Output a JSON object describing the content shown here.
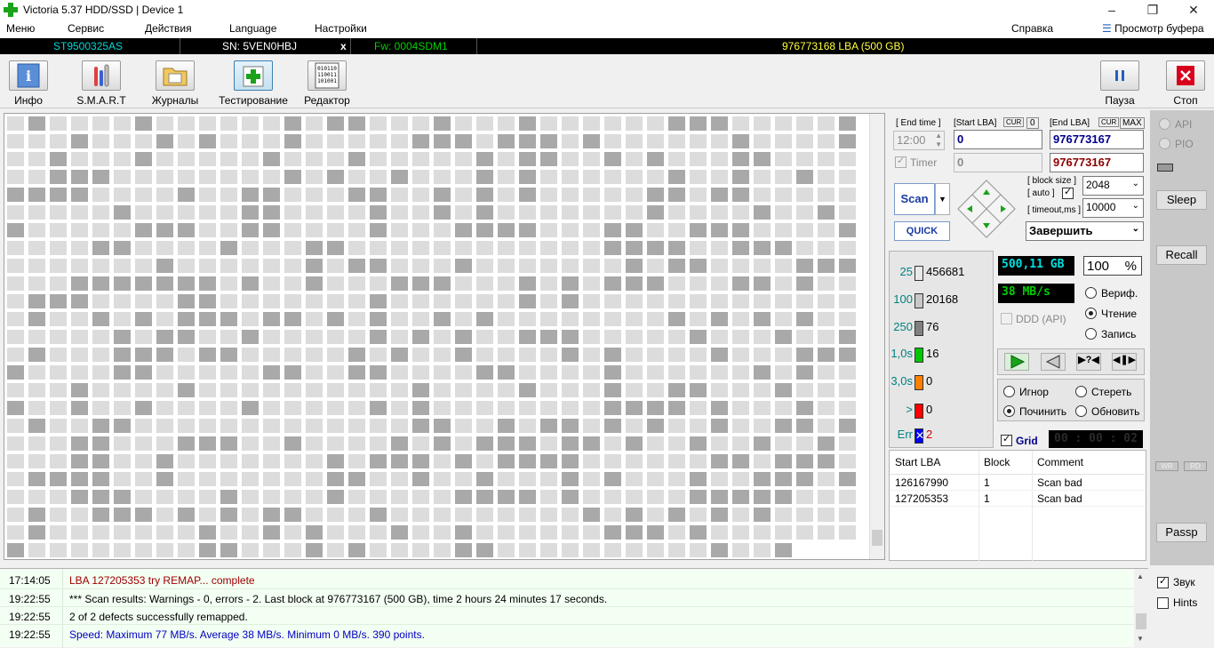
{
  "window": {
    "title": "Victoria 5.37 HDD/SSD | Device 1"
  },
  "menu": {
    "items": [
      "Меню",
      "Сервис",
      "Действия",
      "Language",
      "Настройки"
    ],
    "help": "Справка",
    "buffer_view": "Просмотр буфера"
  },
  "device": {
    "model": "ST9500325AS",
    "serial": "SN: 5VEN0HBJ",
    "close": "x",
    "firmware": "Fw: 0004SDM1",
    "capacity": "976773168 LBA (500 GB)"
  },
  "toolbar": {
    "info": "Инфо",
    "smart": "S.M.A.R.T",
    "logs": "Журналы",
    "testing": "Тестирование",
    "editor": "Редактор",
    "pause": "Пауза",
    "stop": "Стоп"
  },
  "scan": {
    "end_time_label": "[ End time ]",
    "start_lba_label": "[Start LBA]",
    "cur_label": "CUR",
    "cur_value": "0",
    "end_lba_label": "[End LBA]",
    "max_label": "MAX",
    "end_time_value": "12:00",
    "start_lba_value": "0",
    "end_lba_value": "976773167",
    "timer_label": "Timer",
    "timer_value": "0",
    "end_lba_current": "976773167",
    "scan_button": "Scan",
    "quick_button": "QUICK",
    "block_size_label": "[ block size ]",
    "auto_label": "[ auto ]",
    "timeout_label": "[ timeout,ms ]",
    "block_size_value": "2048",
    "timeout_value": "10000",
    "finish_action": "Завершить"
  },
  "legend": [
    {
      "key": "25",
      "value": "456681",
      "color": "#e8e8e8"
    },
    {
      "key": "100",
      "value": "20168",
      "color": "#c8c8c8"
    },
    {
      "key": "250",
      "value": "76",
      "color": "#808080"
    },
    {
      "key": "1,0s",
      "value": "16",
      "color": "#00c800"
    },
    {
      "key": "3,0s",
      "value": "0",
      "color": "#ff8000"
    },
    {
      "key": ">",
      "value": "0",
      "color": "#ff0000"
    },
    {
      "key": "Err",
      "value": "2",
      "color": "#0000ff"
    }
  ],
  "stats": {
    "size": "500,11 GB",
    "percent": "100",
    "percent_unit": "%",
    "speed": "38 MB/s",
    "ddd_label": "DDD (API)",
    "verify": "Вериф.",
    "read": "Чтение",
    "write": "Запись",
    "ignore": "Игнор",
    "erase": "Стереть",
    "repair": "Починить",
    "refresh": "Обновить",
    "grid_label": "Grid",
    "elapsed": "00 : 00 : 02"
  },
  "defects": {
    "columns": [
      "Start LBA",
      "Block",
      "Comment"
    ],
    "rows": [
      {
        "lba": "126167990",
        "block": "1",
        "comment": "Scan bad"
      },
      {
        "lba": "127205353",
        "block": "1",
        "comment": "Scan bad"
      }
    ]
  },
  "sidebar": {
    "api": "API",
    "pio": "PIO",
    "sleep": "Sleep",
    "recall": "Recall",
    "wr": "WR",
    "rd": "RD",
    "passp": "Passp"
  },
  "log": [
    {
      "time": "17:14:05",
      "msg": "LBA 127205353 try REMAP... complete",
      "color": "#a00000"
    },
    {
      "time": "19:22:55",
      "msg": "*** Scan results: Warnings - 0, errors - 2. Last block at 976773167 (500 GB), time 2 hours 24 minutes 17 seconds.",
      "color": "#000000"
    },
    {
      "time": "19:22:55",
      "msg": "2 of 2 defects successfully remapped.",
      "color": "#000000"
    },
    {
      "time": "19:22:55",
      "msg": "Speed: Maximum 77 MB/s. Average 38 MB/s. Minimum 0 MB/s. 390 points.",
      "color": "#0000c0"
    }
  ],
  "log_options": {
    "sound": "Звук",
    "hints": "Hints"
  },
  "colors": {
    "map_light": "#dcdcdc",
    "map_dark": "#a9a9a9",
    "accent_red": "#d9001b"
  }
}
